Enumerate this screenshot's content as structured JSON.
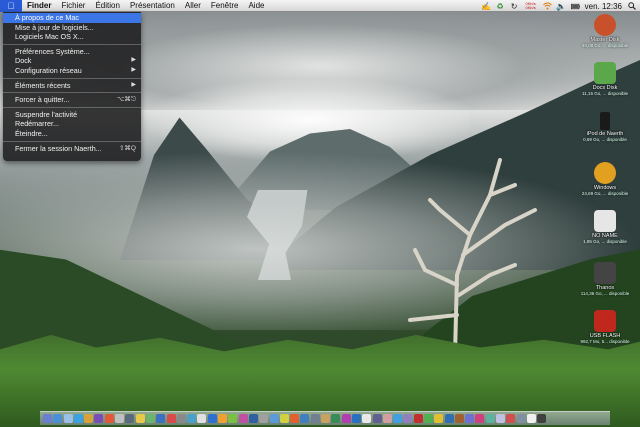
{
  "menubar": {
    "apple_icon": "apple-logo-icon",
    "items": [
      "Finder",
      "Fichier",
      "Édition",
      "Présentation",
      "Aller",
      "Fenêtre",
      "Aide"
    ],
    "status": {
      "battery_small_text": "0%",
      "tiny_text_1": "0Kb/s",
      "tiny_text_2": "0Kb/s",
      "clock": "ven. 12:36"
    }
  },
  "apple_menu": {
    "items": [
      {
        "label": "À propos de ce Mac",
        "shortcut": "",
        "submenu": false,
        "selected": true
      },
      {
        "label": "Mise à jour de logiciels...",
        "shortcut": "",
        "submenu": false
      },
      {
        "label": "Logiciels Mac OS X...",
        "shortcut": "",
        "submenu": false
      },
      {
        "sep": true
      },
      {
        "label": "Préférences Système...",
        "shortcut": "",
        "submenu": false
      },
      {
        "label": "Dock",
        "shortcut": "",
        "submenu": true
      },
      {
        "label": "Configuration réseau",
        "shortcut": "",
        "submenu": true
      },
      {
        "sep": true
      },
      {
        "label": "Éléments récents",
        "shortcut": "",
        "submenu": true
      },
      {
        "sep": true
      },
      {
        "label": "Forcer à quitter...",
        "shortcut": "⌥⌘⎋",
        "submenu": false
      },
      {
        "sep": true
      },
      {
        "label": "Suspendre l'activité",
        "shortcut": "",
        "submenu": false
      },
      {
        "label": "Redémarrer...",
        "shortcut": "",
        "submenu": false
      },
      {
        "label": "Éteindre...",
        "shortcut": "",
        "submenu": false
      },
      {
        "sep": true
      },
      {
        "label": "Fermer la session Naerth...",
        "shortcut": "⇧⌘Q",
        "submenu": false
      }
    ]
  },
  "desktop_icons": [
    {
      "name": "Master Disk",
      "sub": "49,08 Go, ... disponible",
      "color": "#c8502a",
      "icon": "hard-disk-icon"
    },
    {
      "name": "Docs Disk",
      "sub": "11,15 Go, ... disponible",
      "color": "#5aa84a",
      "icon": "hard-disk-icon"
    },
    {
      "name": "iPod de Naerth",
      "sub": "0,69 Go, ... disponible",
      "color": "#1a1a1a",
      "icon": "ipod-icon"
    },
    {
      "name": "Windows",
      "sub": "24,69 Go, ... disponible",
      "color": "#e2a020",
      "icon": "hard-disk-icon"
    },
    {
      "name": "NO NAME",
      "sub": "1,95 Go, ... disponible",
      "color": "#e6e6e6",
      "icon": "removable-disk-icon"
    },
    {
      "name": "Thanos",
      "sub": "114,36 Go, ... disponible",
      "color": "#444444",
      "icon": "hard-disk-icon"
    },
    {
      "name": "USB FLASH",
      "sub": "992,7 Mo, 5... disponible",
      "color": "#c0281e",
      "icon": "usb-drive-icon"
    }
  ],
  "dock": {
    "icon_colors": [
      "#6a7fd1",
      "#4a90d9",
      "#9ac0e8",
      "#3aa3e0",
      "#d8a23a",
      "#7a4fb5",
      "#e05a3a",
      "#c0c0c0",
      "#5a6a7a",
      "#e8c84a",
      "#6cb36c",
      "#3b6fbf",
      "#d94b4b",
      "#8a8a8a",
      "#4aa0c8",
      "#e0e0e0",
      "#2f6fd0",
      "#f0a030",
      "#7bc043",
      "#c050a0",
      "#3060a0",
      "#a0a0a0",
      "#5a9ad8",
      "#d0d040",
      "#e06030",
      "#4080c0",
      "#708090",
      "#c8a060",
      "#3a8a5a",
      "#b040b0",
      "#2a70c0",
      "#e8e8e8",
      "#606090",
      "#d0a0a0",
      "#40a0e0",
      "#9080c0",
      "#c03030",
      "#50b050",
      "#e0c030",
      "#3070b0",
      "#a06030",
      "#7070d0",
      "#d04080",
      "#60b0a0",
      "#c0c0e0",
      "#d05050",
      "#8090a0",
      "#f0f0f0",
      "#404040"
    ]
  }
}
